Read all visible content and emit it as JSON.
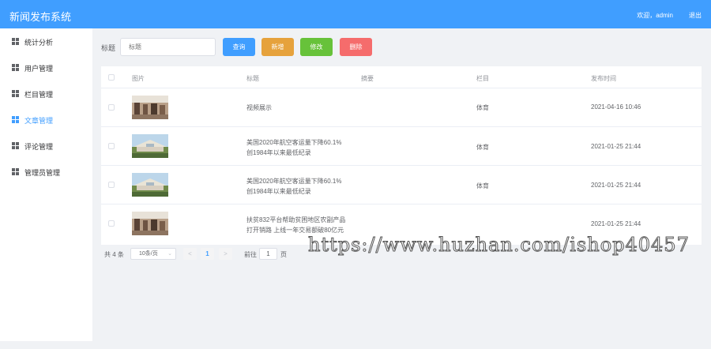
{
  "header": {
    "title": "新闻发布系统",
    "welcome": "欢迎，admin",
    "logout": "退出"
  },
  "sidebar": {
    "items": [
      {
        "label": "统计分析",
        "active": false
      },
      {
        "label": "用户管理",
        "active": false
      },
      {
        "label": "栏目管理",
        "active": false
      },
      {
        "label": "文章管理",
        "active": true
      },
      {
        "label": "评论管理",
        "active": false
      },
      {
        "label": "管理员管理",
        "active": false
      }
    ]
  },
  "search": {
    "label": "标题",
    "placeholder": "标题",
    "query_label": "查询",
    "add_label": "新增",
    "edit_label": "修改",
    "delete_label": "删除"
  },
  "table": {
    "headers": [
      "图片",
      "标题",
      "摘要",
      "栏目",
      "发布时间"
    ],
    "rows": [
      {
        "title_1": "视频展示",
        "title_2": "",
        "category": "体育",
        "time": "2021-04-16 10:46",
        "thumb": "indoor"
      },
      {
        "title_1": "美国2020年航空客运量下降60.1%",
        "title_2": "创1984年以来最低纪录",
        "category": "体育",
        "time": "2021-01-25 21:44",
        "thumb": "plane"
      },
      {
        "title_1": "美国2020年航空客运量下降60.1%",
        "title_2": "创1984年以来最低纪录",
        "category": "体育",
        "time": "2021-01-25 21:44",
        "thumb": "plane"
      },
      {
        "title_1": "扶贫832平台帮助贫困地区农副产品",
        "title_2": "打开销路 上线一年交易额破80亿元",
        "category": "",
        "time": "2021-01-25 21:44",
        "thumb": "indoor"
      }
    ]
  },
  "pagination": {
    "total": "共 4 条",
    "page_size": "10条/页",
    "prev": "<",
    "current": "1",
    "next": ">",
    "goto_label": "前往",
    "goto_value": "1",
    "page_suffix": "页"
  },
  "watermark": "https://www.huzhan.com/ishop40457",
  "colors": {
    "primary": "#409eff",
    "warning": "#e6a23c",
    "success": "#67c23a",
    "danger": "#f56c6c"
  }
}
